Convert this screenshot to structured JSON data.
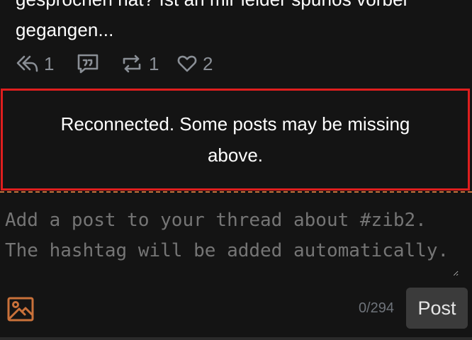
{
  "post": {
    "text_line1": "gesprochen hat? Ist an mir leider spurlos vorbei",
    "text_line2": "gegangen..."
  },
  "actions": {
    "reply_icon": "reply-icon",
    "reply_count": "1",
    "quote_icon": "quote-icon",
    "boost_icon": "repost-icon",
    "boost_count": "1",
    "like_icon": "heart-icon",
    "like_count": "2"
  },
  "banner": {
    "message": "Reconnected. Some posts may be missing above.",
    "border_color": "#e01e1e"
  },
  "composer": {
    "placeholder": "Add a post to your thread about #zib2. The hashtag will be added automatically.",
    "image_icon": "image-icon",
    "char_count": "0/294",
    "post_label": "Post",
    "accent_color": "#c9713a"
  }
}
